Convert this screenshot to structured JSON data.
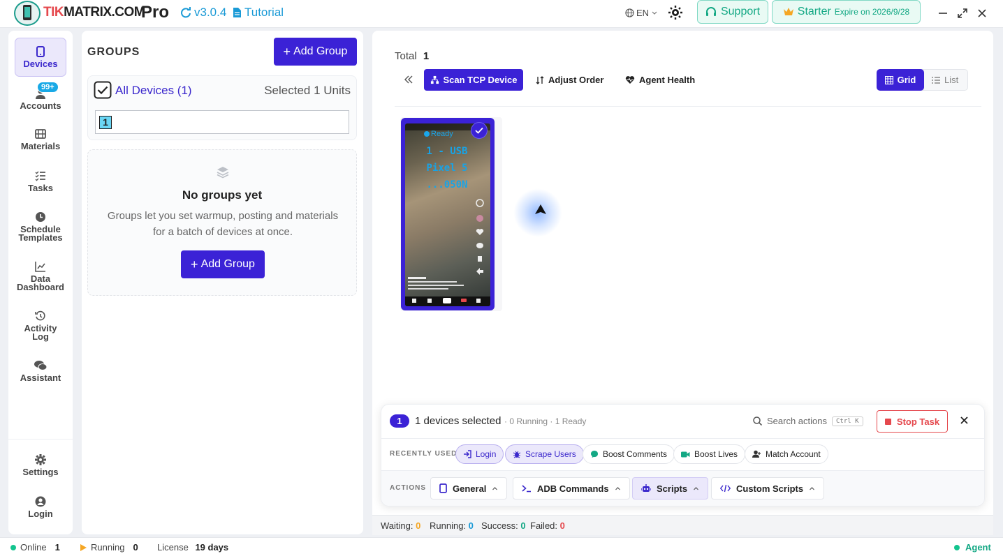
{
  "app": {
    "brand": "TIKMATRIX.COM",
    "edition": "Pro",
    "version": "v3.0.4",
    "tutorial": "Tutorial",
    "lang": "EN",
    "support": "Support",
    "plan": "Starter",
    "expire": "Expire on 2026/9/28"
  },
  "nav": [
    {
      "label": "Devices",
      "icon": "phone-icon"
    },
    {
      "label": "Accounts",
      "icon": "user-icon",
      "badge": "99+"
    },
    {
      "label": "Materials",
      "icon": "film-icon"
    },
    {
      "label": "Tasks",
      "icon": "checklist-icon"
    },
    {
      "label": "Schedule Templates",
      "icon": "clock-icon"
    },
    {
      "label": "Data Dashboard",
      "icon": "chart-line-icon"
    },
    {
      "label": "Activity Log",
      "icon": "history-icon"
    },
    {
      "label": "Assistant",
      "icon": "chat-icon"
    },
    {
      "label": "Settings",
      "icon": "gear-icon"
    },
    {
      "label": "Login",
      "icon": "user-circle-icon"
    }
  ],
  "groups": {
    "title": "GROUPS",
    "add_label": "Add Group",
    "all_devices": "All Devices (1)",
    "selected": "Selected 1 Units",
    "device_chip": "1",
    "empty_title": "No groups yet",
    "empty_desc": "Groups let you set warmup, posting and materials for a batch of devices at once.",
    "empty_add_label": "Add Group"
  },
  "main": {
    "total_label": "Total",
    "total_value": "1",
    "scan": "Scan TCP Device",
    "adjust": "Adjust Order",
    "agent": "Agent Health",
    "grid": "Grid",
    "list": "List",
    "device": {
      "status": "Ready",
      "line1": "1 - USB",
      "line2": "Pixel 5",
      "line3": "...050N"
    }
  },
  "panel": {
    "count": "1",
    "selected_text": "1 devices selected",
    "meta": "· 0 Running · 1 Ready",
    "search": "Search actions",
    "shortcut": "Ctrl K",
    "stop": "Stop Task",
    "recent_label": "RECENTLY USED",
    "recent": [
      {
        "label": "Login",
        "icon": "login-icon"
      },
      {
        "label": "Scrape Users",
        "icon": "bug-icon"
      },
      {
        "label": "Boost Comments",
        "icon": "comment-icon"
      },
      {
        "label": "Boost Lives",
        "icon": "video-icon"
      },
      {
        "label": "Match Account",
        "icon": "user-link-icon"
      }
    ],
    "actions_label": "ACTIONS",
    "actions": [
      {
        "label": "General",
        "icon": "phone-icon"
      },
      {
        "label": "ADB Commands",
        "icon": "terminal-icon"
      },
      {
        "label": "Scripts",
        "icon": "robot-icon"
      },
      {
        "label": "Custom Scripts",
        "icon": "code-icon"
      }
    ]
  },
  "counts": {
    "waiting_label": "Waiting:",
    "waiting": "0",
    "running_label": "Running:",
    "running": "0",
    "success_label": "Success:",
    "success": "0",
    "failed_label": "Failed:",
    "failed": "0"
  },
  "status": {
    "online_label": "Online",
    "online": "1",
    "running_label": "Running",
    "running": "0",
    "license_label": "License",
    "license": "19 days",
    "agent": "Agent"
  },
  "colors": {
    "primary": "#3b22d6",
    "accent_green": "#13a884",
    "link_blue": "#1a9ad6",
    "danger": "#e5484d"
  }
}
